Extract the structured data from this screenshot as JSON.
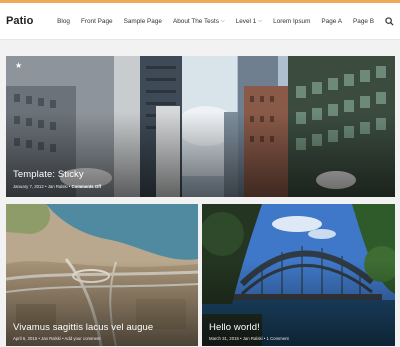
{
  "site": {
    "title": "Patio"
  },
  "nav": [
    {
      "label": "Blog",
      "dropdown": false
    },
    {
      "label": "Front Page",
      "dropdown": false
    },
    {
      "label": "Sample Page",
      "dropdown": false
    },
    {
      "label": "About The Tests",
      "dropdown": true
    },
    {
      "label": "Level 1",
      "dropdown": true
    },
    {
      "label": "Lorem Ipsum",
      "dropdown": false
    },
    {
      "label": "Page A",
      "dropdown": false
    },
    {
      "label": "Page B",
      "dropdown": false
    }
  ],
  "posts": {
    "sticky": {
      "title": "Template: Sticky",
      "meta_date": "January 7, 2012",
      "meta_author": "Jan Ralski",
      "meta_comments": "Comments Off",
      "icon": "star-icon"
    },
    "second": {
      "title": "Vivamus sagittis lacus vel augue",
      "meta_date": "April 6, 2015",
      "meta_author": "Jan Ralski",
      "meta_comments": "Add your comment"
    },
    "third": {
      "title": "Hello world!",
      "meta_date": "March 31, 2015",
      "meta_author": "Jan Ralski",
      "meta_comments": "1 Comment"
    }
  },
  "colors": {
    "accent": "#f0a95a",
    "header_bg": "#ffffff",
    "page_bg": "#f2f2f2"
  }
}
